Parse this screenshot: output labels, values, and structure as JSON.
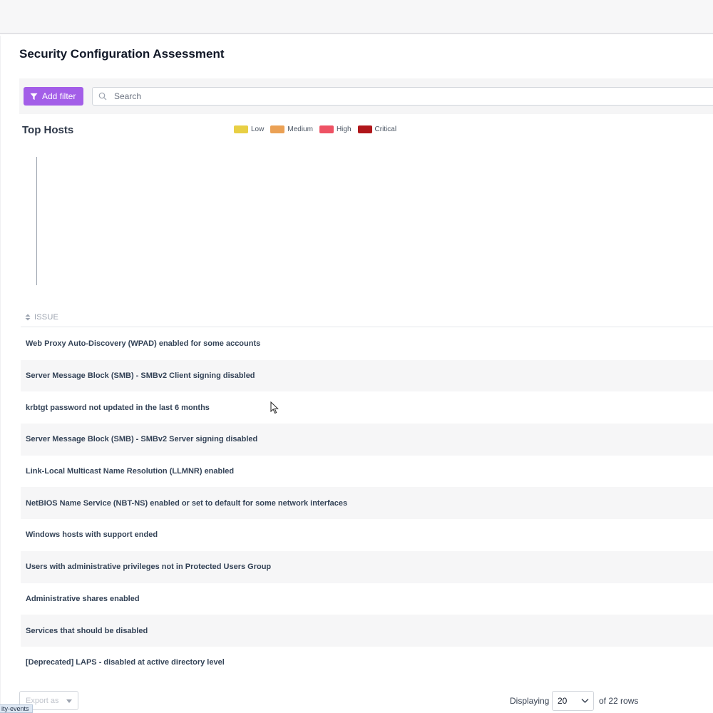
{
  "page": {
    "title": "Security Configuration Assessment"
  },
  "filters": {
    "add_filter_label": "Add filter",
    "search_placeholder": "Search"
  },
  "chart": {
    "title": "Top Hosts",
    "legend": [
      {
        "label": "Low",
        "color": "#e8cf44"
      },
      {
        "label": "Medium",
        "color": "#eba155"
      },
      {
        "label": "High",
        "color": "#ee5264"
      },
      {
        "label": "Critical",
        "color": "#b0161a"
      }
    ]
  },
  "table": {
    "column_header": "ISSUE",
    "rows": [
      "Web Proxy Auto-Discovery (WPAD) enabled for some accounts",
      "Server Message Block (SMB) - SMBv2 Client signing disabled",
      "krbtgt password not updated in the last 6 months",
      "Server Message Block (SMB) - SMBv2 Server signing disabled",
      "Link-Local Multicast Name Resolution (LLMNR) enabled",
      "NetBIOS Name Service (NBT-NS) enabled or set to default for some network interfaces",
      "Windows hosts with support ended",
      "Users with administrative privileges not in Protected Users Group",
      "Administrative shares enabled",
      "Services that should be disabled",
      "[Deprecated] LAPS - disabled at active directory level"
    ]
  },
  "footer": {
    "export_label": "Export as",
    "displaying_label": "Displaying",
    "rows_per_page": "20",
    "rows_total_label": "of 22 rows"
  },
  "status_bar": {
    "url_fragment": "ity-events"
  }
}
